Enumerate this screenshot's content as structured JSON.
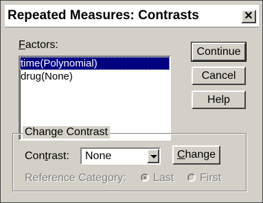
{
  "title": "Repeated Measures: Contrasts",
  "factors": {
    "label": "Factors:",
    "items": [
      "time(Polynomial)",
      "drug(None)"
    ],
    "selected_index": 0
  },
  "buttons": {
    "continue": "Continue",
    "cancel": "Cancel",
    "help": "Help",
    "change": "Change"
  },
  "change_contrast": {
    "group_label": "Change Contrast",
    "contrast_label": "Contrast:",
    "contrast_value": "None",
    "reference_label": "Reference Category:",
    "last_label": "Last",
    "first_label": "First",
    "selected_reference": "Last"
  },
  "colors": {
    "selection": "#000080",
    "face": "#d4d0c8"
  }
}
